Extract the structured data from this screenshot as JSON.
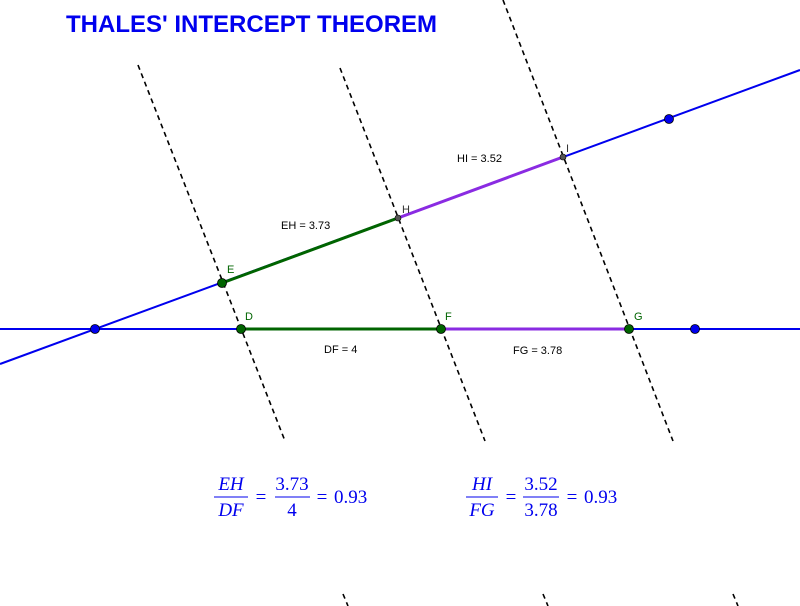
{
  "title": "THALES' INTERCEPT THEOREM",
  "colors": {
    "blue_line": "#0000ee",
    "green_segment": "#006400",
    "purple_segment": "#8a2be2",
    "dashed_line": "#000000",
    "title": "#0000ee"
  },
  "points": {
    "E": "E",
    "H": "H",
    "I": "I",
    "D": "D",
    "F": "F",
    "G": "G"
  },
  "measurements": {
    "EH": "EH = 3.73",
    "HI": "HI = 3.52",
    "DF": "DF = 4",
    "FG": "FG = 3.78"
  },
  "formula1": {
    "num_var": "EH",
    "den_var": "DF",
    "eq1": "=",
    "num_val": "3.73",
    "den_val": "4",
    "eq2": "=",
    "result": "0.93"
  },
  "formula2": {
    "num_var": "HI",
    "den_var": "FG",
    "eq1": "=",
    "num_val": "3.52",
    "den_val": "3.78",
    "eq2": "=",
    "result": "0.93"
  }
}
